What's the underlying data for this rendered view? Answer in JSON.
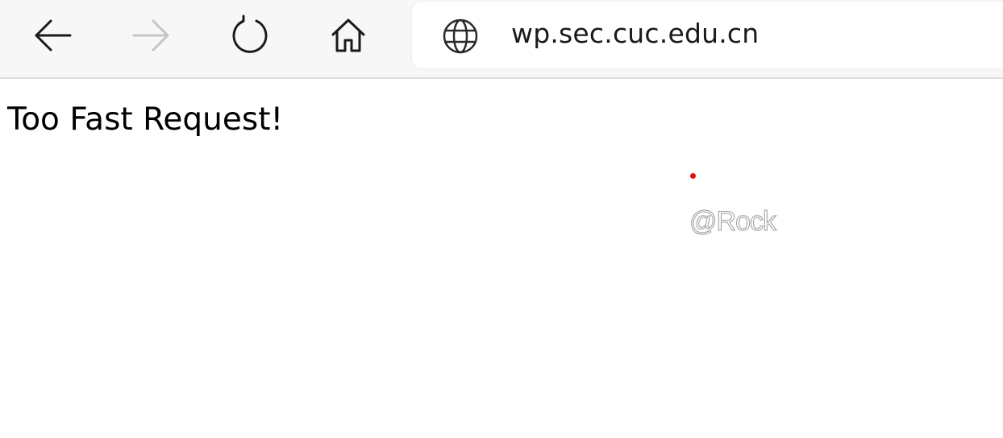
{
  "browser": {
    "nav": {
      "back_icon": "arrow-left-icon",
      "forward_icon": "arrow-right-icon",
      "refresh_icon": "refresh-icon",
      "home_icon": "home-icon"
    },
    "address_bar": {
      "site_icon": "globe-icon",
      "url": "wp.sec.cuc.edu.cn"
    }
  },
  "page": {
    "message": "Too Fast Request!",
    "watermark": "@Rock"
  },
  "colors": {
    "toolbar_bg": "#f7f7f7",
    "dot": "#e01010",
    "disabled_icon": "#c4c4c4"
  }
}
